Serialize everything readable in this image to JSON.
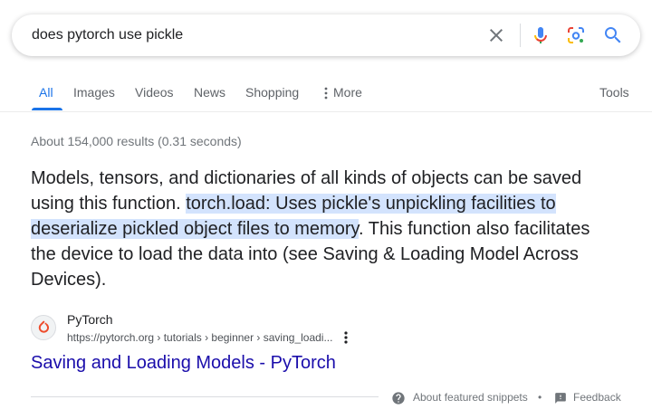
{
  "search": {
    "query": "does pytorch use pickle"
  },
  "icons": {
    "clear": "close-icon",
    "voice": "mic-icon",
    "lens": "google-lens-icon",
    "search": "search-icon"
  },
  "tabs": [
    {
      "label": "All",
      "active": true
    },
    {
      "label": "Images"
    },
    {
      "label": "Videos"
    },
    {
      "label": "News"
    },
    {
      "label": "Shopping"
    },
    {
      "label": "More"
    }
  ],
  "tools_label": "Tools",
  "stats": "About 154,000 results (0.31 seconds)",
  "snippet": {
    "text_before": "Models, tensors, and dictionaries of all kinds of objects can be saved using this function. ",
    "highlighted": "torch.load: Uses pickle's unpickling facilities to deserialize pickled object files to memory",
    "text_after": ". This function also facilitates the device to load the data into (see Saving & Loading Model Across Devices)."
  },
  "result": {
    "site_name": "PyTorch",
    "breadcrumb": "https://pytorch.org › tutorials › beginner › saving_loadi...",
    "title": "Saving and Loading Models - PyTorch"
  },
  "footer": {
    "about": "About featured snippets",
    "separator": "•",
    "feedback": "Feedback"
  },
  "colors": {
    "accent": "#1a73e8",
    "link": "#1a0dab",
    "highlight": "#d3e3fd",
    "pytorch": "#ee4c2c"
  }
}
